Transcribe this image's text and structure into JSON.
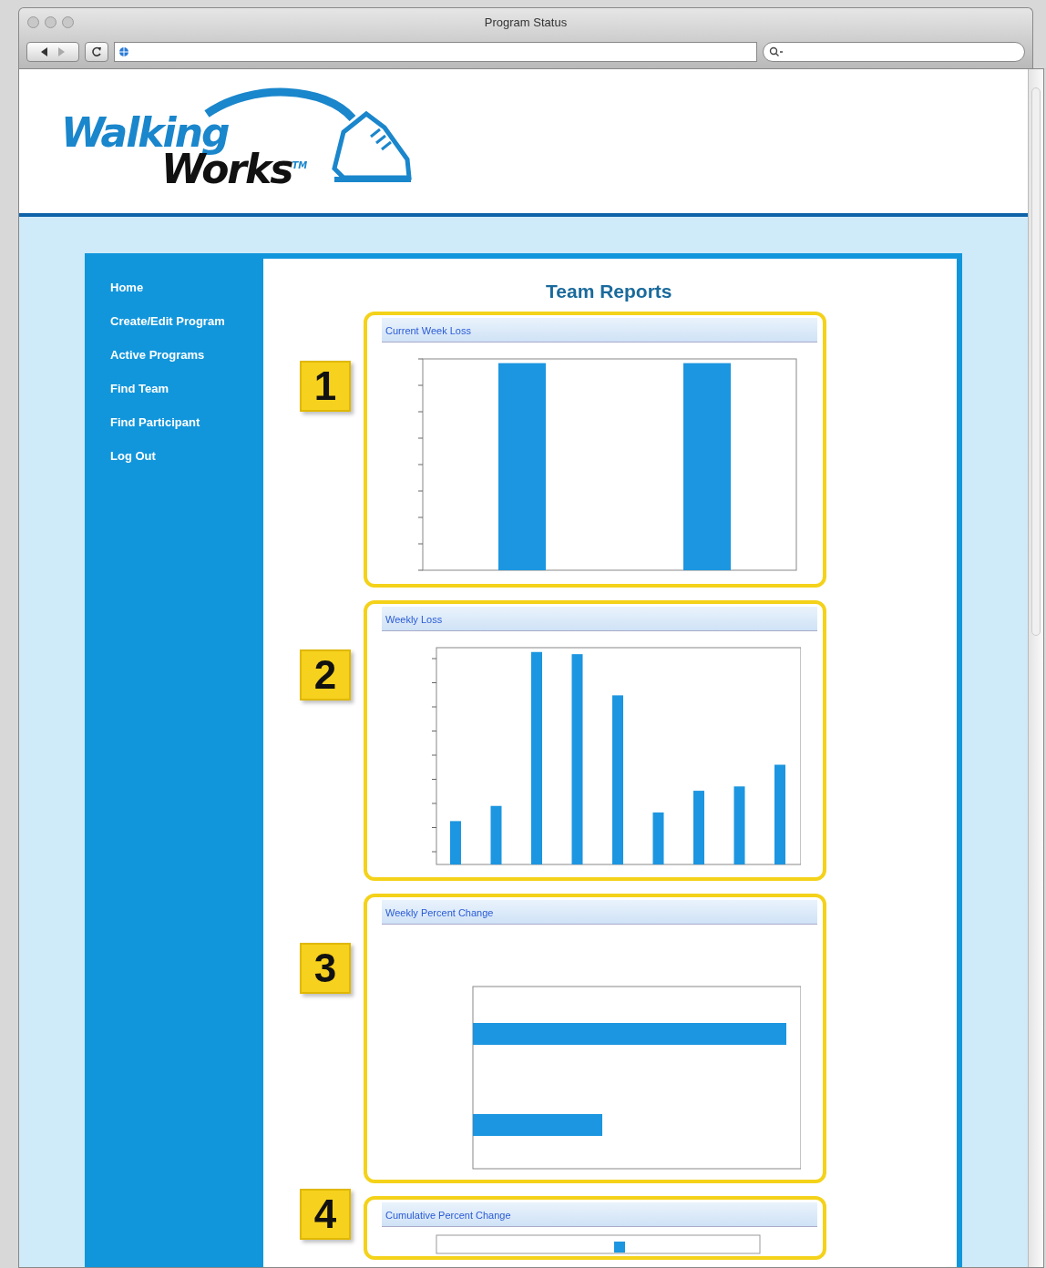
{
  "window": {
    "title": "Program Status"
  },
  "logo": {
    "word_1": "Walking",
    "word_2": "Works",
    "mark": "TM"
  },
  "nav": [
    {
      "label": "Home"
    },
    {
      "label": "Create/Edit Program"
    },
    {
      "label": "Active Programs"
    },
    {
      "label": "Find Team"
    },
    {
      "label": "Find Participant"
    },
    {
      "label": "Log Out"
    }
  ],
  "page_title": "Team Reports",
  "reports": [
    {
      "callout": "1",
      "title": "Current Week Loss",
      "kind": "columns"
    },
    {
      "callout": "2",
      "title": "Weekly Loss",
      "kind": "columns_many"
    },
    {
      "callout": "3",
      "title": "Weekly Percent Change",
      "kind": "bars"
    },
    {
      "callout": "4",
      "title": "Cumulative Percent Change",
      "kind": "gauge"
    }
  ]
}
